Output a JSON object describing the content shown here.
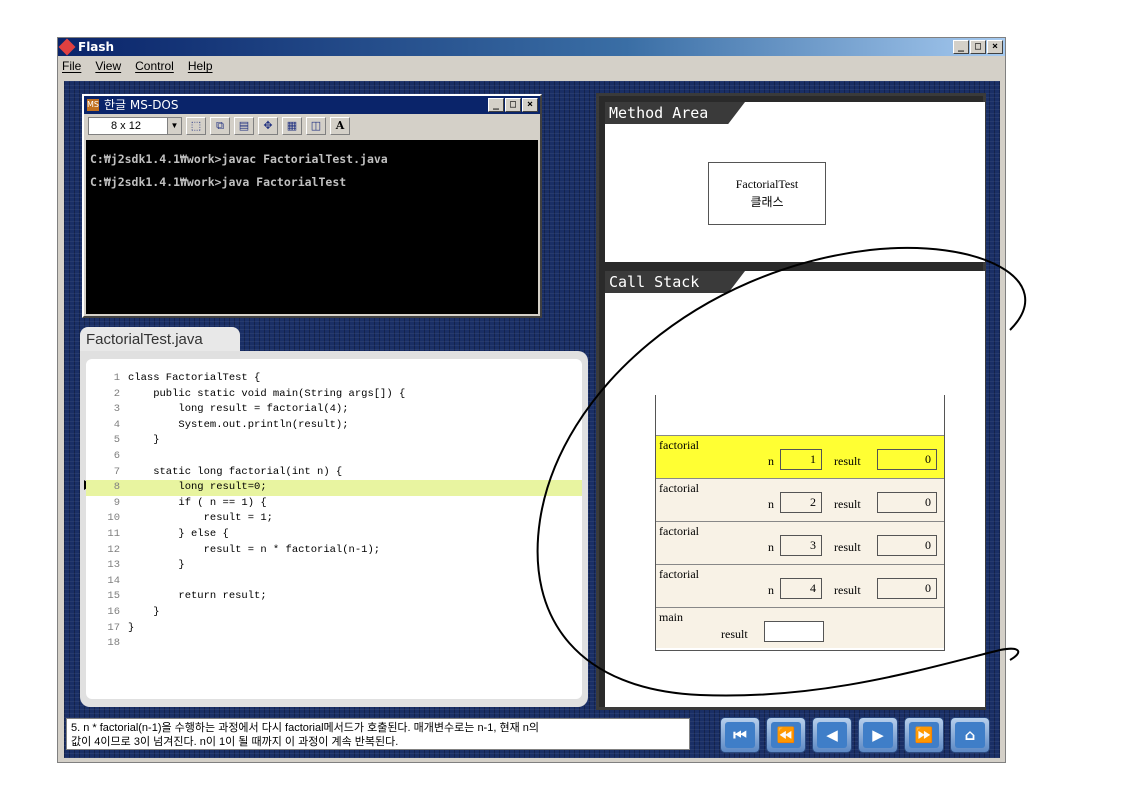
{
  "window": {
    "title": "Flash",
    "buttons": [
      "_",
      "□",
      "×"
    ],
    "menu": [
      "File",
      "View",
      "Control",
      "Help"
    ]
  },
  "dos": {
    "title": "한글 MS-DOS",
    "font_size": "8 x 12",
    "lines": [
      "C:₩j2sdk1.4.1₩work>javac FactorialTest.java",
      "C:₩j2sdk1.4.1₩work>java FactorialTest"
    ]
  },
  "code": {
    "filename": "FactorialTest.java",
    "current_line": 8,
    "lines": [
      {
        "n": "1",
        "text": "class FactorialTest {"
      },
      {
        "n": "2",
        "text": "    public static void main(String args[]) {"
      },
      {
        "n": "3",
        "text": "        long result = factorial(4);"
      },
      {
        "n": "4",
        "text": "        System.out.println(result);"
      },
      {
        "n": "5",
        "text": "    }"
      },
      {
        "n": "6",
        "text": ""
      },
      {
        "n": "7",
        "text": "    static long factorial(int n) {"
      },
      {
        "n": "8",
        "text": "        long result=0;"
      },
      {
        "n": "9",
        "text": "        if ( n == 1) {"
      },
      {
        "n": "10",
        "text": "            result = 1;"
      },
      {
        "n": "11",
        "text": "        } else {"
      },
      {
        "n": "12",
        "text": "            result = n * factorial(n-1);"
      },
      {
        "n": "13",
        "text": "        }"
      },
      {
        "n": "14",
        "text": ""
      },
      {
        "n": "15",
        "text": "        return result;"
      },
      {
        "n": "16",
        "text": "    }"
      },
      {
        "n": "17",
        "text": "}"
      },
      {
        "n": "18",
        "text": ""
      }
    ]
  },
  "method_area": {
    "label": "Method Area",
    "class_name": "FactorialTest",
    "class_suffix": "클래스"
  },
  "call_stack": {
    "label": "Call Stack",
    "frames": [
      {
        "name": "factorial",
        "n_label": "n",
        "n": "1",
        "result_label": "result",
        "result": "0",
        "active": true
      },
      {
        "name": "factorial",
        "n_label": "n",
        "n": "2",
        "result_label": "result",
        "result": "0",
        "active": false
      },
      {
        "name": "factorial",
        "n_label": "n",
        "n": "3",
        "result_label": "result",
        "result": "0",
        "active": false
      },
      {
        "name": "factorial",
        "n_label": "n",
        "n": "4",
        "result_label": "result",
        "result": "0",
        "active": false
      }
    ],
    "main": {
      "name": "main",
      "result_label": "result",
      "result": ""
    }
  },
  "description": {
    "line1": "5. n * factorial(n-1)을 수행하는 과정에서 다시 factorial메서드가 호출된다. 매개변수로는 n-1, 현재 n의",
    "line2": "값이 4이므로 3이 넘겨진다. n이 1이 될 때까지 이 과정이 계속 반복된다."
  },
  "nav": {
    "buttons": [
      "first",
      "rewind",
      "prev",
      "next",
      "forward",
      "home"
    ],
    "glyphs": [
      "⏮",
      "⏪",
      "◀",
      "▶",
      "⏩",
      "⌂"
    ]
  },
  "colors": {
    "active_frame": "#ffff33",
    "highlight_line": "#e8f4a0",
    "titlebar": "#0a246a",
    "stage": "#1a2f66"
  }
}
